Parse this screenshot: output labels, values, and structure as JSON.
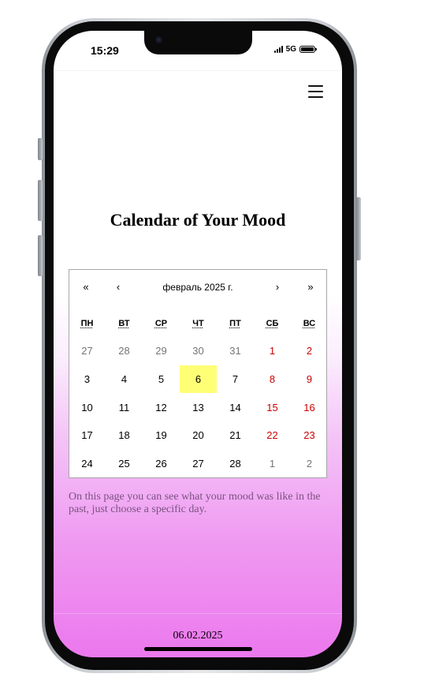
{
  "status_bar": {
    "time": "15:29",
    "network": "5G"
  },
  "header": {
    "menu_icon": "hamburger-menu-icon"
  },
  "main": {
    "title": "Calendar of Your Mood",
    "description": "On this page you can see what your mood was like in the past, just choose a specific day."
  },
  "calendar": {
    "month_label": "февраль 2025 г.",
    "prev_year": "«",
    "prev_month": "‹",
    "next_month": "›",
    "next_year": "»",
    "weekdays": [
      "ПН",
      "ВТ",
      "СР",
      "ЧТ",
      "ПТ",
      "СБ",
      "ВС"
    ],
    "weeks": [
      [
        "27",
        "28",
        "29",
        "30",
        "31",
        "1",
        "2"
      ],
      [
        "3",
        "4",
        "5",
        "6",
        "7",
        "8",
        "9"
      ],
      [
        "10",
        "11",
        "12",
        "13",
        "14",
        "15",
        "16"
      ],
      [
        "17",
        "18",
        "19",
        "20",
        "21",
        "22",
        "23"
      ],
      [
        "24",
        "25",
        "26",
        "27",
        "28",
        "1",
        "2"
      ]
    ],
    "today": "6",
    "colors": {
      "weekend": "#cd0000",
      "outside_month": "#757575",
      "today_highlight": "#ffff76"
    }
  },
  "footer": {
    "date": "06.02.2025"
  }
}
